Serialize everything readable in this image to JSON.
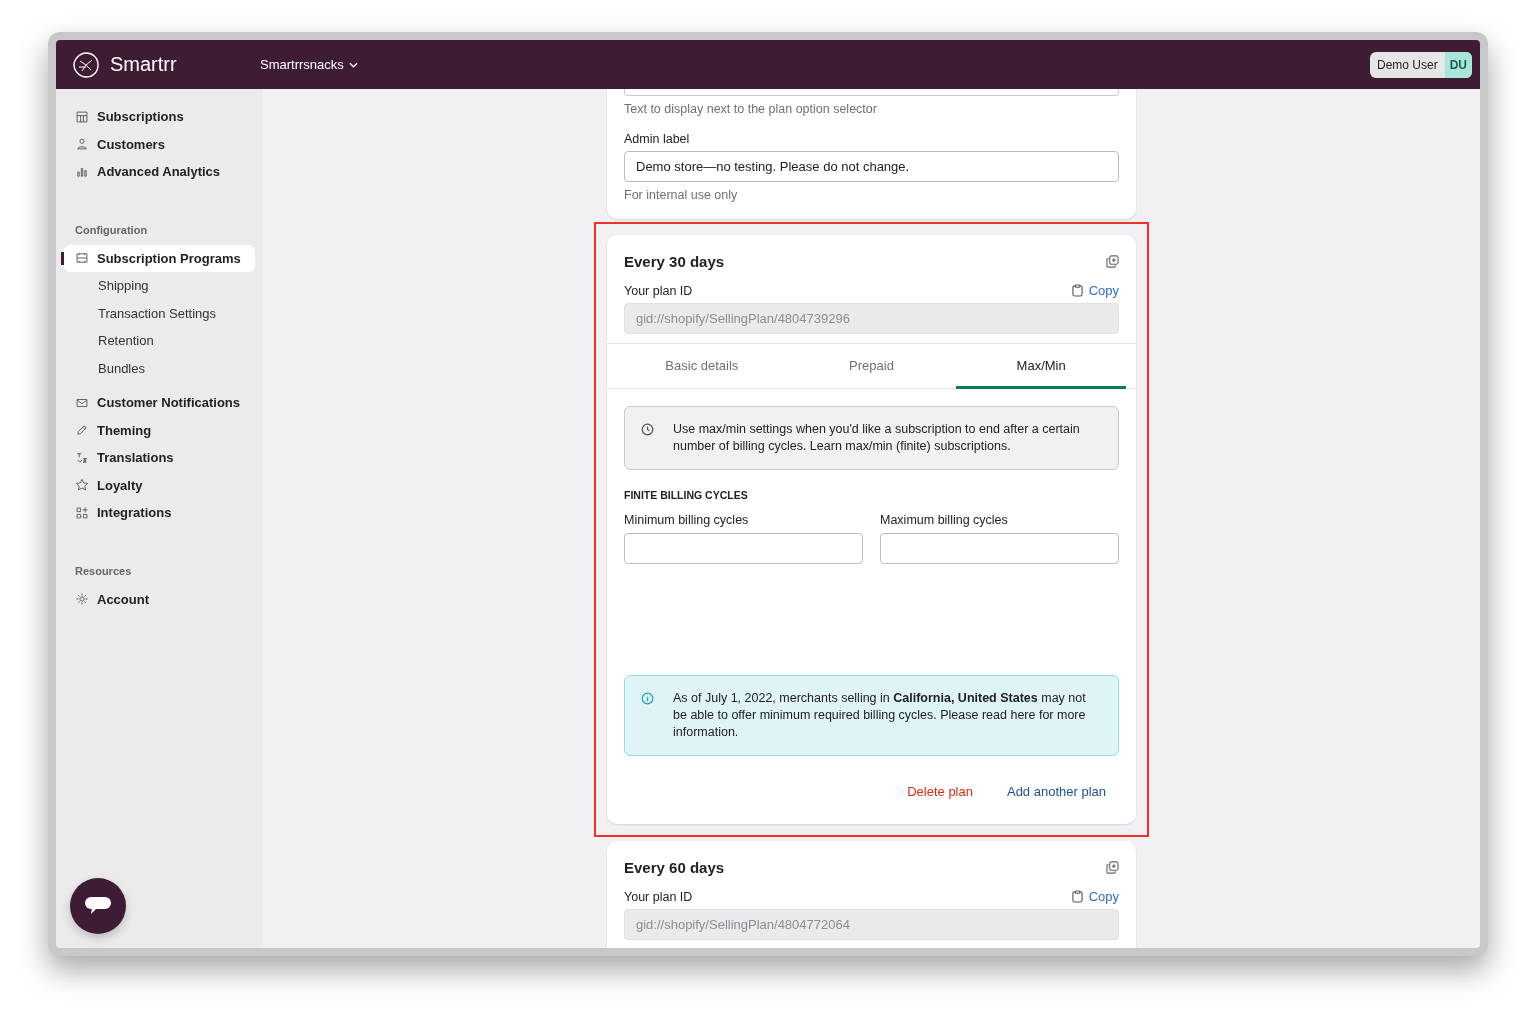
{
  "header": {
    "brand": "Smartrr",
    "store": "Smartrrsnacks",
    "user": "Demo User",
    "initials": "DU"
  },
  "sidebar": [
    {
      "items": [
        {
          "label": "Subscriptions",
          "selected": false
        },
        {
          "label": "Customers",
          "selected": false
        },
        {
          "label": "Advanced Analytics",
          "selected": false
        }
      ]
    },
    {
      "heading": "Configuration",
      "items": [
        {
          "label": "Subscription Programs",
          "selected": true,
          "children": [
            {
              "label": "Shipping",
              "selected": false
            },
            {
              "label": "Transaction Settings",
              "selected": false
            },
            {
              "label": "Retention",
              "selected": false
            },
            {
              "label": "Bundles",
              "selected": false
            }
          ]
        },
        {
          "label": "Customer Notifications",
          "selected": false
        },
        {
          "label": "Theming",
          "selected": false
        },
        {
          "label": "Translations",
          "selected": false
        },
        {
          "label": "Loyalty",
          "selected": false
        },
        {
          "label": "Integrations",
          "selected": false
        }
      ]
    },
    {
      "heading": "Resources",
      "items": [
        {
          "label": "Account",
          "selected": false
        }
      ]
    }
  ],
  "top_card": {
    "hint": "Text to display next to the plan option selector",
    "label": "Admin label",
    "value": "Demo store—no testing. Please do not change.",
    "help": "For internal use only"
  },
  "plans": [
    {
      "title": "Every 30 days",
      "highlighted": true,
      "id_label": "Your plan ID",
      "copy": "Copy",
      "id_value": "gid://shopify/SellingPlan/4804739296",
      "tabs": [
        {
          "label": "Basic details",
          "selected": false
        },
        {
          "label": "Prepaid",
          "selected": false
        },
        {
          "label": "Max/Min",
          "selected": true
        }
      ],
      "note": "Use max/min settings when you'd like a subscription to end after a certain number of billing cycles. Learn max/min (finite) subscriptions.",
      "section": "FINITE BILLING CYCLES",
      "fields": [
        {
          "label": "Minimum billing cycles"
        },
        {
          "label": "Maximum billing cycles"
        }
      ],
      "alert": "As of July 1, 2022, merchants selling in **California, United States** may not be able to offer minimum required billing cycles. Please read here for more information.",
      "actions": [
        {
          "label": "Delete plan",
          "kind": "danger"
        },
        {
          "label": "Add another plan",
          "kind": "primary"
        }
      ]
    },
    {
      "title": "Every 60 days",
      "highlighted": false,
      "id_label": "Your plan ID",
      "copy": "Copy",
      "id_value": "gid://shopify/SellingPlan/4804772064"
    }
  ]
}
